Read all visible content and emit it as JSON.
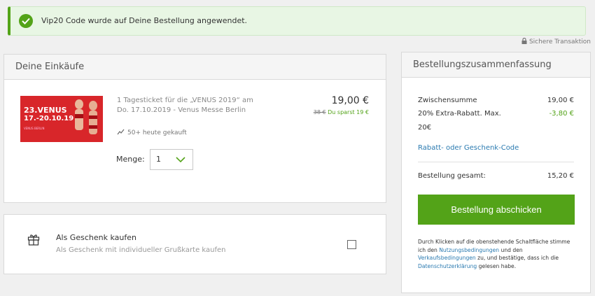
{
  "alert": {
    "icon": "check-circle-icon",
    "text": "Vip20 Code wurde auf Deine Bestellung angewendet."
  },
  "secure": {
    "icon": "lock-icon",
    "label": "Sichere Transaktion"
  },
  "cart": {
    "heading": "Deine Einkäufe",
    "item": {
      "image_text_line1": "23.VENUS",
      "image_text_line2": "17.-20.10.19",
      "image_text_small": "VENUS BERLIN",
      "title_line1": "1 Tagesticket für die „VENUS 2019“ am",
      "title_line2": "Do. 17.10.2019 - Venus Messe Berlin",
      "price": "19,00 €",
      "old_price": "38 €",
      "savings": "Du sparst 19 €",
      "sold_icon": "trend-up-icon",
      "sold_text": "50+ heute gekauft",
      "qty_label": "Menge:",
      "qty_value": "1",
      "qty_icon": "chevron-down-icon"
    }
  },
  "gift": {
    "icon": "gift-icon",
    "title": "Als Geschenk kaufen",
    "subtitle": "Als Geschenk mit individueller Grußkarte kaufen",
    "checked": false
  },
  "summary": {
    "heading": "Bestellungszusammenfassung",
    "subtotal_label": "Zwischensumme",
    "subtotal_value": "19,00 €",
    "discount_label_line1": "20% Extra-Rabatt. Max.",
    "discount_label_line2": "20€",
    "discount_value": "-3,80 €",
    "promo_link": "Rabatt- oder Geschenk-Code",
    "total_label": "Bestellung gesamt:",
    "total_value": "15,20 €",
    "submit_label": "Bestellung abschicken",
    "legal": {
      "part1": "Durch Klicken auf die obenstehende Schaltfläche stimme ich den ",
      "link1": "Nutzungsbedingungen",
      "part2": " und den ",
      "link2": "Verkaufsbedingungen",
      "part3": " zu, und bestätige, dass ich die ",
      "link3": "Datenschutzerklärung",
      "part4": " gelesen habe."
    }
  },
  "colors": {
    "accent_green": "#53a318",
    "link_blue": "#2a7ab0",
    "alert_bg": "#e8f6e4",
    "page_bg": "#f0f0f0"
  }
}
